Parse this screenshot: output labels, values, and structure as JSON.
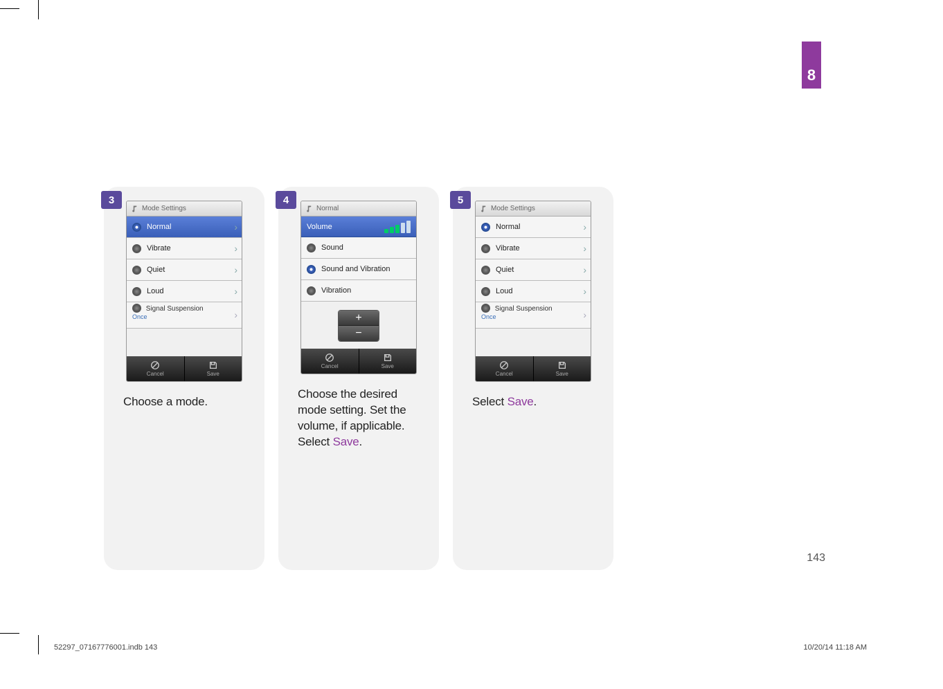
{
  "chapter_tab": "8",
  "page_number": "143",
  "footer": {
    "left": "52297_07167776001.indb   143",
    "right": "10/20/14   11:18 AM"
  },
  "steps": [
    {
      "num": "3",
      "phone": {
        "header": "Mode Settings",
        "rows": [
          {
            "label": "Normal",
            "selected": true
          },
          {
            "label": "Vibrate",
            "selected": false
          },
          {
            "label": "Quiet",
            "selected": false
          },
          {
            "label": "Loud",
            "selected": false
          }
        ],
        "signal_row": {
          "title": "Signal Suspension",
          "sub": "Once"
        },
        "footer": {
          "cancel": "Cancel",
          "save": "Save"
        }
      },
      "caption_plain": "Choose a mode."
    },
    {
      "num": "4",
      "phone": {
        "header": "Normal",
        "volume_label": "Volume",
        "rows": [
          {
            "label": "Sound",
            "selected": false
          },
          {
            "label": "Sound and Vibration",
            "selected": true
          },
          {
            "label": "Vibration",
            "selected": false
          }
        ],
        "footer": {
          "cancel": "Cancel",
          "save": "Save"
        }
      },
      "caption_plain": "Choose the desired mode setting. Set the volume, if applicable. Select ",
      "caption_accent": "Save",
      "caption_after": "."
    },
    {
      "num": "5",
      "phone": {
        "header": "Mode Settings",
        "rows": [
          {
            "label": "Normal",
            "selected": true
          },
          {
            "label": "Vibrate",
            "selected": false
          },
          {
            "label": "Quiet",
            "selected": false
          },
          {
            "label": "Loud",
            "selected": false
          }
        ],
        "signal_row": {
          "title": "Signal Suspension",
          "sub": "Once"
        },
        "footer": {
          "cancel": "Cancel",
          "save": "Save"
        }
      },
      "caption_plain": "Select ",
      "caption_accent": "Save",
      "caption_after": "."
    }
  ]
}
